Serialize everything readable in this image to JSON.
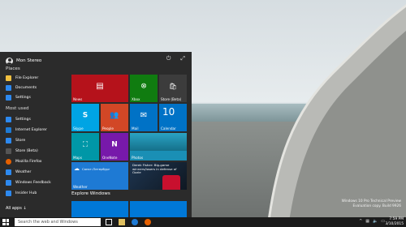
{
  "user": {
    "name": "Mon Stereo"
  },
  "places": {
    "label": "Places",
    "items": [
      {
        "label": "File Explorer",
        "color": "#f0c040",
        "icon": "folder-icon"
      },
      {
        "label": "Documents",
        "color": "#2d89ef",
        "icon": "document-icon"
      },
      {
        "label": "Settings",
        "color": "#2d89ef",
        "icon": "gear-icon"
      }
    ]
  },
  "most_used": {
    "label": "Most used",
    "items": [
      {
        "label": "Settings",
        "color": "#2d89ef",
        "icon": "gear-icon"
      },
      {
        "label": "Internet Explorer",
        "color": "#1e7ad4",
        "icon": "internet-explorer-icon"
      },
      {
        "label": "Store",
        "color": "#2d89ef",
        "icon": "store-icon"
      },
      {
        "label": "Store (Beta)",
        "color": "#555555",
        "icon": "store-beta-icon"
      },
      {
        "label": "Mozilla Firefox",
        "color": "#e66000",
        "icon": "firefox-icon"
      },
      {
        "label": "Weather",
        "color": "#2d89ef",
        "icon": "weather-icon"
      },
      {
        "label": "Windows Feedback",
        "color": "#2d89ef",
        "icon": "feedback-icon"
      },
      {
        "label": "Insider Hub",
        "color": "#2d89ef",
        "icon": "insider-hub-icon"
      }
    ]
  },
  "all_apps": "All apps ↓",
  "tiles": {
    "news": {
      "label": "News",
      "color": "#b5121b"
    },
    "xbox": {
      "label": "Xbox",
      "color": "#107c10"
    },
    "store_beta": {
      "label": "Store (Beta)",
      "color": "#3c3c3c"
    },
    "skype": {
      "label": "Skype",
      "color": "#00a4e4"
    },
    "people": {
      "label": "People",
      "color": "#d24726"
    },
    "mail": {
      "label": "Mail",
      "color": "#0072c6"
    },
    "calendar": {
      "label": "Calendar",
      "value": "10",
      "color": "#0072c6"
    },
    "maps": {
      "label": "Maps",
      "color": "#0097a7"
    },
    "onenote": {
      "label": "OneNote",
      "color": "#7719aa"
    },
    "photos": {
      "label": "Photos",
      "color": "#1a8fb5"
    },
    "weather": {
      "label": "Weather",
      "city": "Санкт-Петербург",
      "color": "#1e7ad4"
    },
    "sports": {
      "headline": "Derek Fisher: Big-game winners/losers in defense of Ozzie"
    }
  },
  "explore": "Explore Windows",
  "taskbar": {
    "search_placeholder": "Search the web and Windows"
  },
  "watermark": {
    "line1": "Windows 10 Pro Technical Preview",
    "line2": "Evaluation copy. Build 9926"
  },
  "clock": {
    "time": "7:59 PM",
    "date": "3/10/2015"
  }
}
